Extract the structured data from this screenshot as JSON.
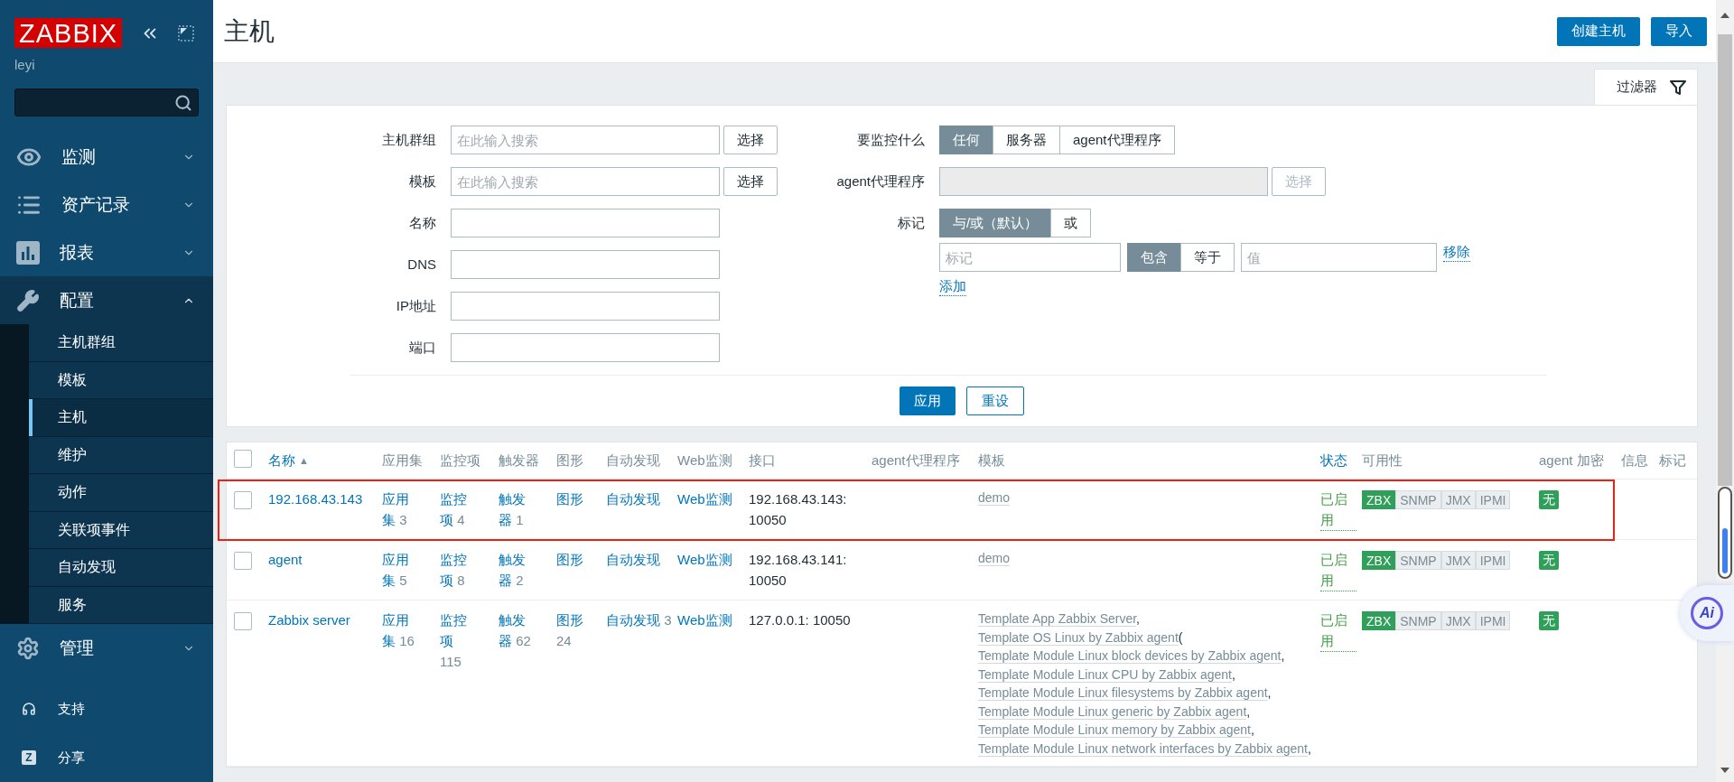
{
  "sidebar": {
    "logo": "ZABBIX",
    "user": "leyi",
    "menu": [
      {
        "label": "监测",
        "expanded": false
      },
      {
        "label": "资产记录",
        "expanded": false
      },
      {
        "label": "报表",
        "expanded": false
      },
      {
        "label": "配置",
        "expanded": true,
        "children": [
          {
            "label": "主机群组",
            "selected": false
          },
          {
            "label": "模板",
            "selected": false
          },
          {
            "label": "主机",
            "selected": true
          },
          {
            "label": "维护",
            "selected": false
          },
          {
            "label": "动作",
            "selected": false
          },
          {
            "label": "关联项事件",
            "selected": false
          },
          {
            "label": "自动发现",
            "selected": false
          },
          {
            "label": "服务",
            "selected": false
          }
        ]
      },
      {
        "label": "管理",
        "expanded": false
      }
    ],
    "footer": [
      {
        "label": "支持"
      },
      {
        "label": "分享",
        "badge": "Z"
      }
    ]
  },
  "header": {
    "title": "主机",
    "buttons": [
      "创建主机",
      "导入"
    ]
  },
  "filter": {
    "tab": {
      "label": "过滤器",
      "selected": true
    },
    "fields": [
      {
        "label": "主机群组",
        "kind": "multiselect",
        "placeholder": "在此输入搜索",
        "button": "选择"
      },
      {
        "label": "模板",
        "kind": "multiselect",
        "placeholder": "在此输入搜索",
        "button": "选择"
      },
      {
        "label": "名称",
        "kind": "text"
      },
      {
        "label": "DNS",
        "kind": "text"
      },
      {
        "label": "IP地址",
        "kind": "text"
      },
      {
        "label": "端口",
        "kind": "text"
      }
    ],
    "monitored_by": {
      "label": "要监控什么",
      "options": [
        {
          "label": "任何",
          "selected": true
        },
        {
          "label": "服务器",
          "selected": false
        },
        {
          "label": "agent代理程序",
          "selected": false
        }
      ]
    },
    "proxy": {
      "label": "agent代理程序",
      "disabled": true,
      "button": "选择"
    },
    "tags": {
      "label": "标记",
      "operators": [
        {
          "label": "与/或（默认）",
          "selected": true
        },
        {
          "label": "或",
          "selected": false
        }
      ],
      "rows": [
        {
          "tag_placeholder": "标记",
          "conditions": [
            {
              "label": "包含",
              "selected": true
            },
            {
              "label": "等于",
              "selected": false
            }
          ],
          "value_placeholder": "值",
          "remove": "移除"
        }
      ],
      "add": "添加"
    },
    "apply": "应用",
    "reset": "重设"
  },
  "table": {
    "select_all": {
      "checked": false
    },
    "columns": [
      {
        "label": "名称",
        "link": true,
        "sort_indicator": "▲"
      },
      {
        "label": "应用集",
        "link": false
      },
      {
        "label": "监控项",
        "link": false
      },
      {
        "label": "触发器",
        "link": false
      },
      {
        "label": "图形",
        "link": false
      },
      {
        "label": "自动发现",
        "link": false
      },
      {
        "label": "Web监测",
        "link": false
      },
      {
        "label": "接口",
        "link": false
      },
      {
        "label": "agent代理程序",
        "link": false
      },
      {
        "label": "模板",
        "link": false
      },
      {
        "label": "状态",
        "link": true
      },
      {
        "label": "可用性",
        "link": false
      },
      {
        "label": "agent 加密",
        "link": false
      },
      {
        "label": "信息",
        "link": false
      },
      {
        "label": "标记",
        "link": false
      }
    ],
    "rows": [
      {
        "checked": false,
        "highlighted": true,
        "name": "192.168.43.143",
        "links": [
          {
            "label": "应用集",
            "count": "3"
          },
          {
            "label": "监控项",
            "count": "4"
          },
          {
            "label": "触发器",
            "count": "1"
          },
          {
            "label": "图形"
          },
          {
            "label": "自动发现"
          },
          {
            "label": "Web监测"
          }
        ],
        "interface": "192.168.43.143: 10050",
        "templates": [
          {
            "name": "demo"
          }
        ],
        "status": "已启用",
        "availability": [
          {
            "label": "ZBX",
            "on": true
          },
          {
            "label": "SNMP",
            "on": false
          },
          {
            "label": "JMX",
            "on": false
          },
          {
            "label": "IPMI",
            "on": false
          }
        ],
        "encryption": "无"
      },
      {
        "checked": false,
        "highlighted": false,
        "name": "agent",
        "links": [
          {
            "label": "应用集",
            "count": "5"
          },
          {
            "label": "监控项",
            "count": "8"
          },
          {
            "label": "触发器",
            "count": "2"
          },
          {
            "label": "图形"
          },
          {
            "label": "自动发现"
          },
          {
            "label": "Web监测"
          }
        ],
        "interface": "192.168.43.141: 10050",
        "templates": [
          {
            "name": "demo"
          }
        ],
        "status": "已启用",
        "availability": [
          {
            "label": "ZBX",
            "on": true
          },
          {
            "label": "SNMP",
            "on": false
          },
          {
            "label": "JMX",
            "on": false
          },
          {
            "label": "IPMI",
            "on": false
          }
        ],
        "encryption": "无"
      },
      {
        "checked": false,
        "highlighted": false,
        "name": "Zabbix server",
        "links": [
          {
            "label": "应用集",
            "count": "16"
          },
          {
            "label": "监控项",
            "count": "115"
          },
          {
            "label": "触发器",
            "count": "62"
          },
          {
            "label": "图形",
            "count": "24"
          },
          {
            "label": "自动发现",
            "count": "3"
          },
          {
            "label": "Web监测"
          }
        ],
        "interface": "127.0.0.1: 10050",
        "templates": [
          {
            "name": "Template App Zabbix Server",
            "after": ","
          },
          {
            "name": "Template OS Linux by Zabbix agent",
            "after": "("
          },
          {
            "name": "Template Module Linux block devices by Zabbix agent",
            "after": ","
          },
          {
            "name": "Template Module Linux CPU by Zabbix agent",
            "after": ","
          },
          {
            "name": "Template Module Linux filesystems by Zabbix agent",
            "after": ","
          },
          {
            "name": "Template Module Linux generic by Zabbix agent",
            "after": ","
          },
          {
            "name": "Template Module Linux memory by Zabbix agent",
            "after": ","
          },
          {
            "name": "Template Module Linux network interfaces by Zabbix agent",
            "after": ","
          }
        ],
        "status": "已启用",
        "availability": [
          {
            "label": "ZBX",
            "on": true
          },
          {
            "label": "SNMP",
            "on": false
          },
          {
            "label": "JMX",
            "on": false
          },
          {
            "label": "IPMI",
            "on": false
          }
        ],
        "encryption": "无"
      }
    ]
  },
  "assistant": {
    "label": "Ai"
  }
}
